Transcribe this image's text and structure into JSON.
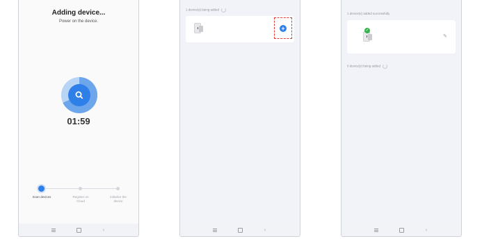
{
  "screen1": {
    "title": "Adding device...",
    "subtitle": "Power on the device.",
    "timer": "01:59",
    "steps": [
      {
        "label": "Scan devices"
      },
      {
        "label": "Register on Cloud"
      },
      {
        "label": "Initialize the device"
      }
    ]
  },
  "screen2": {
    "adding_text": "1 device(s) being added",
    "add_icon": "plus-icon"
  },
  "screen3": {
    "success_text": "1 device(s) added successfully",
    "adding_text": "0 device(s) being added"
  },
  "colors": {
    "accent": "#2f7fe8",
    "success": "#35b34a",
    "highlight": "#e53935"
  }
}
